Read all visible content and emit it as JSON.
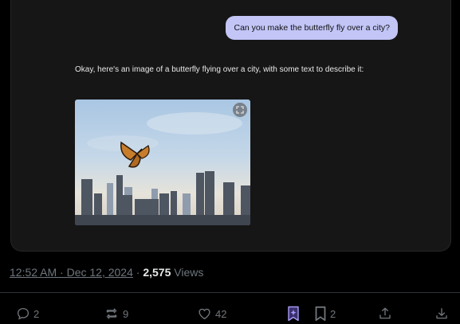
{
  "chat": {
    "user_message": "Can you make the butterfly fly over a city?",
    "assistant_message": "Okay, here's an image of a butterfly flying over a city, with some text to describe it:"
  },
  "post_meta": {
    "timestamp": "12:52 AM · Dec 12, 2024",
    "separator": "·",
    "views_count": "2,575",
    "views_label": "Views"
  },
  "actions": {
    "replies": "2",
    "reposts": "9",
    "likes": "42",
    "bookmarks": "2"
  },
  "colors": {
    "bubble": "#c2c5f6",
    "grok_icon": "#a79cf5",
    "muted": "#6e767d"
  }
}
